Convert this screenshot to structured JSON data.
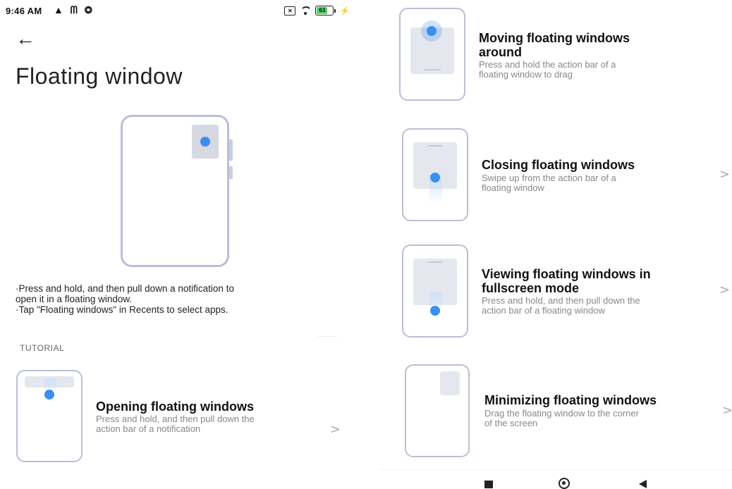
{
  "status_bar": {
    "time": "9:46 AM",
    "left_icons": "▲ ᗰ ◎",
    "battery_level": "63",
    "battery_fraction": 0.63
  },
  "header": {
    "title": "Floating window"
  },
  "instructions": [
    "·Press and hold, and then pull down a notification to\nopen it in a floating window.",
    "·Tap \"Floating windows\" in Recents to select apps."
  ],
  "section_label": "TUTORIAL",
  "tutorials": [
    {
      "title": "Opening floating windows",
      "desc": "Press and hold, and then pull down the\naction bar of a notification",
      "chevron": ">"
    },
    {
      "title": "Moving floating windows\naround",
      "desc": "Press and hold the action bar of a\nfloating window to drag",
      "chevron": ""
    },
    {
      "title": "Closing floating windows",
      "desc": "Swipe up from the action bar of a\nfloating window",
      "chevron": ">"
    },
    {
      "title": "Viewing floating windows in\nfullscreen mode",
      "desc": "Press and hold, and then pull down the\naction bar of a floating window",
      "chevron": ">"
    },
    {
      "title": "Minimizing floating windows",
      "desc": "Drag the floating window to the corner\nof the screen",
      "chevron": ">"
    }
  ],
  "colors": {
    "accent": "#3b8ff0",
    "outline": "#b9bfd6"
  }
}
